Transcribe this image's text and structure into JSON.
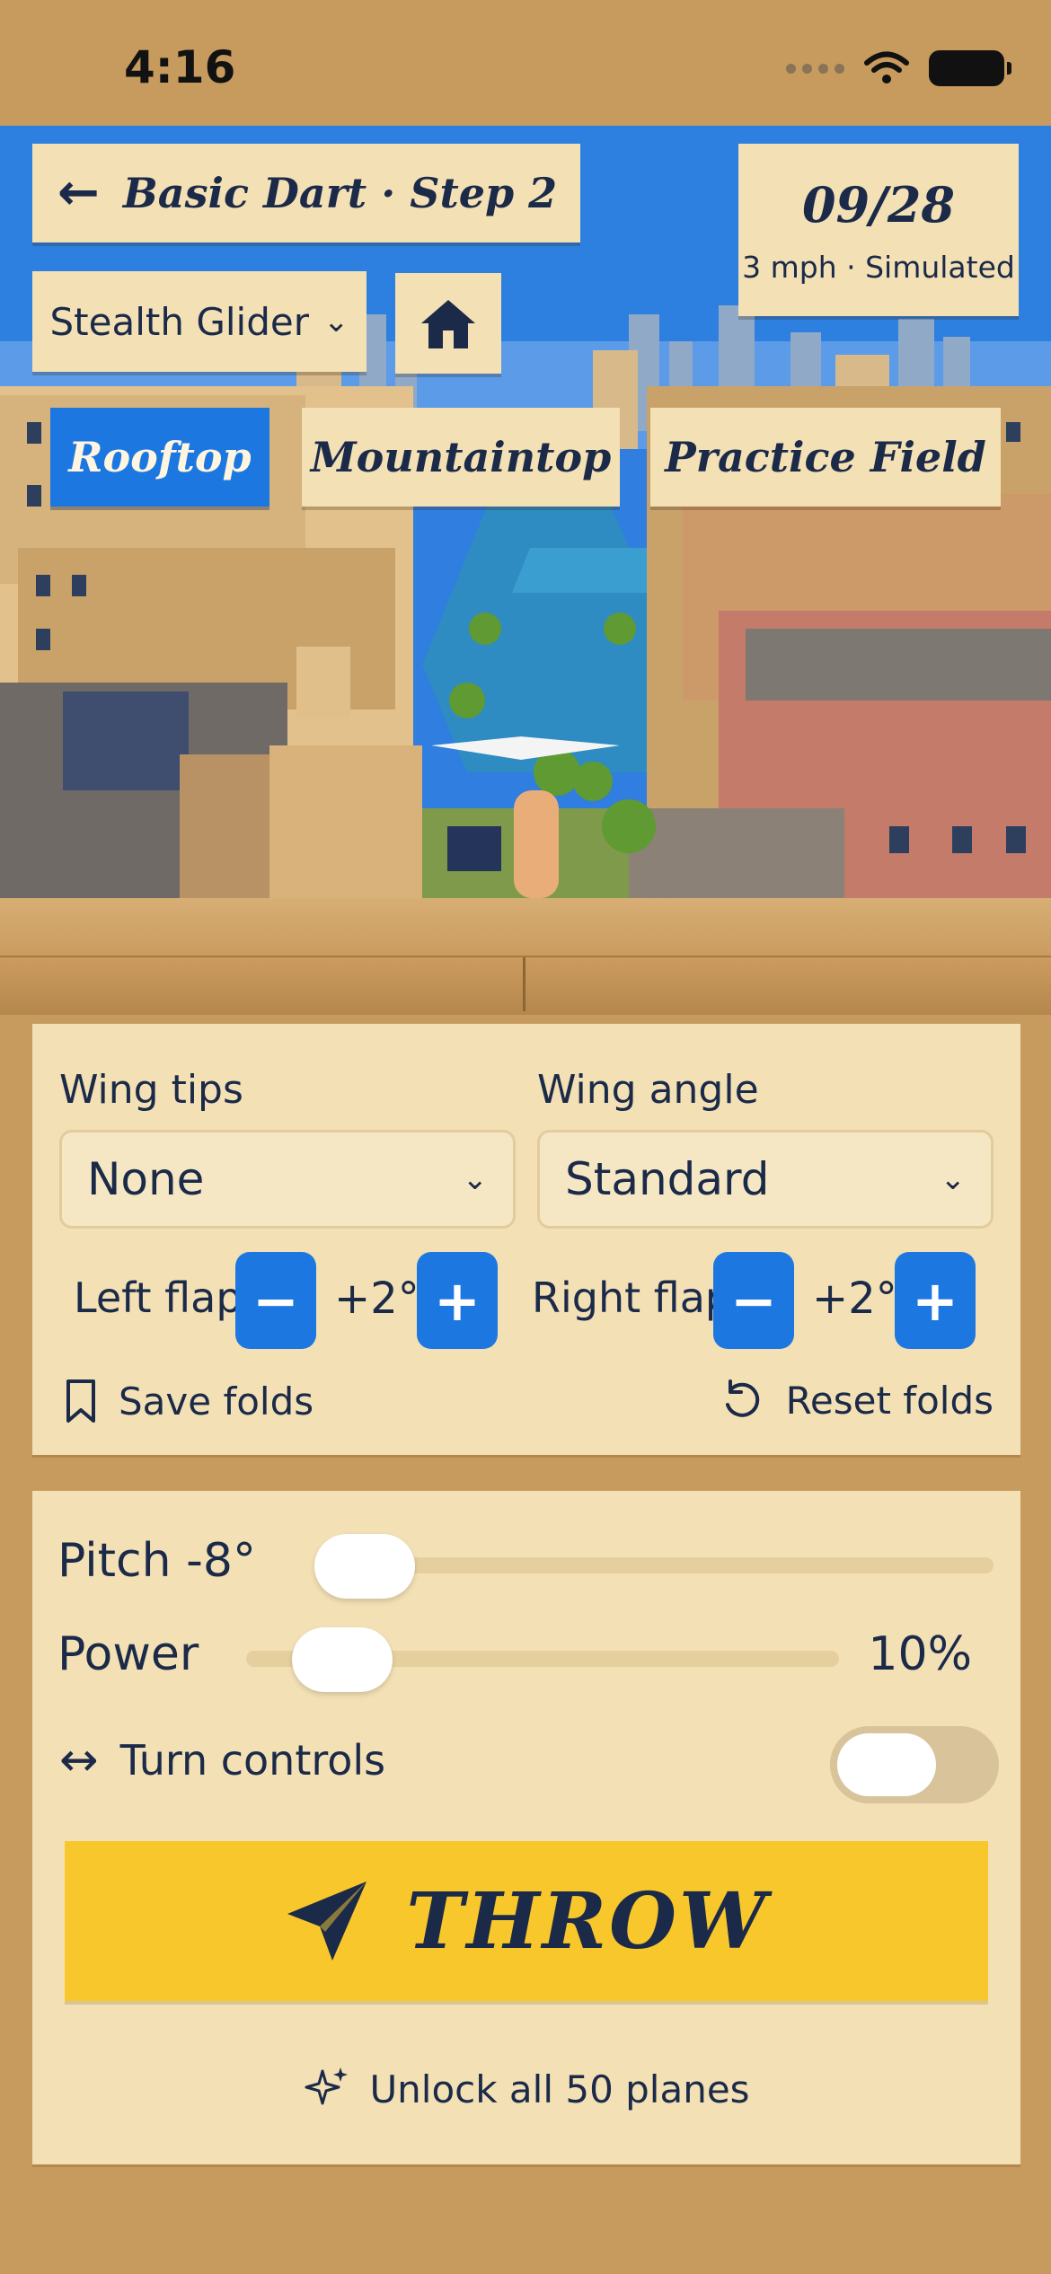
{
  "status_bar": {
    "time": "4:16"
  },
  "header": {
    "title": "Basic Dart · Step 2",
    "date": "09/28",
    "weather": "3 mph · Simulated",
    "plane_select": "Stealth Glider"
  },
  "locations": [
    {
      "label": "Rooftop",
      "active": true
    },
    {
      "label": "Mountaintop",
      "active": false
    },
    {
      "label": "Practice Field",
      "active": false
    }
  ],
  "folds": {
    "wing_tips_label": "Wing tips",
    "wing_tips_value": "None",
    "wing_angle_label": "Wing angle",
    "wing_angle_value": "Standard",
    "left_flap_label": "Left flap",
    "left_flap_value": "+2°",
    "right_flap_label": "Right flap",
    "right_flap_value": "+2°",
    "minus": "−",
    "plus": "+",
    "save_label": "Save folds",
    "reset_label": "Reset folds"
  },
  "launch": {
    "pitch_label": "Pitch -8°",
    "pitch_fraction": 0.0,
    "power_label": "Power",
    "power_value": "10%",
    "power_fraction": 0.1,
    "turn_label": "Turn controls",
    "turn_enabled": false,
    "throw_label": "THROW",
    "unlock_label": "Unlock all 50 planes"
  },
  "colors": {
    "accent_blue": "#1c78e0",
    "throw_yellow": "#f7c72c",
    "paper": "#f3e0b5",
    "ink": "#1b2a48",
    "cardboard": "#c79a5e"
  }
}
